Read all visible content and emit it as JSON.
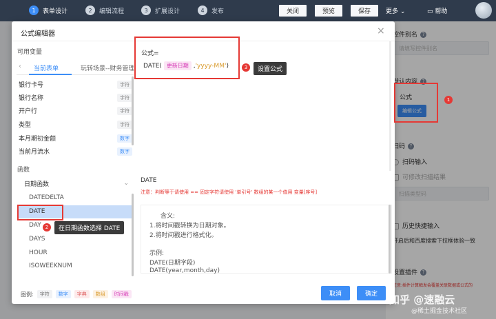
{
  "topbar": {
    "steps": [
      {
        "num": "1",
        "label": "表单设计"
      },
      {
        "num": "2",
        "label": "编辑流程"
      },
      {
        "num": "3",
        "label": "扩展设计"
      },
      {
        "num": "4",
        "label": "发布"
      }
    ],
    "buttons": {
      "close": "关闭",
      "preview": "预览",
      "save": "保存"
    },
    "more": "更多",
    "help": "帮助"
  },
  "right_panel": {
    "alias_label": "控件别名",
    "alias_placeholder": "请填写控件别名",
    "default_label": "默认内容",
    "default_value": "公式",
    "edit_formula": "编辑公式",
    "scan_label": "扫码",
    "scan_input": "扫码输入",
    "scan_modify": "可修改扫描结果",
    "scan_type": "扫描类型码",
    "history": "历史快捷输入",
    "baidu": "开启后和百度搜索下拉框体验一致",
    "plugin_label": "设置插件",
    "plugin_note": "注意:插件计算触发会覆盖关联数据或公式的"
  },
  "modal": {
    "title": "公式编辑器",
    "available_vars": "可用变量",
    "tabs": [
      "当前表单",
      "玩转场景--财务管理"
    ],
    "fields": [
      {
        "name": "银行卡号",
        "type": "字符"
      },
      {
        "name": "银行名称",
        "type": "字符"
      },
      {
        "name": "开户行",
        "type": "字符"
      },
      {
        "name": "类型",
        "type": "字符"
      },
      {
        "name": "本月期初金额",
        "type": "数字"
      },
      {
        "name": "当前月流水",
        "type": "数字"
      }
    ],
    "functions_label": "函数",
    "fn_group": "日期函数",
    "functions": [
      "DATEDELTA",
      "DATE",
      "DAY",
      "DAYS",
      "HOUR",
      "ISOWEEKNUM"
    ],
    "formula_label": "公式=",
    "formula": {
      "fn": "DATE(",
      "field": "更新日期",
      "comma": ",",
      "fmt": "'yyyy-MM'",
      "close": ")"
    },
    "fn_name": "DATE",
    "note": "注意：判断等于请使用 == 固定字符请使用 '单引号' 数组的某一个值用 变量[序号]",
    "desc": {
      "title": "含义:",
      "lines": [
        "1.将时间戳转换为日期对象。",
        "2.将时间戳进行格式化。"
      ],
      "example_title": "示例:",
      "examples": [
        "DATE(日期字段)",
        "DATE(year,month,day)"
      ]
    },
    "legend": {
      "label": "图例:",
      "items": [
        "字符",
        "数字",
        "字典",
        "数组",
        "时间戳"
      ]
    },
    "cancel": "取消",
    "confirm": "确定"
  },
  "annotations": {
    "m1": "1",
    "m2": "2",
    "m3": "3",
    "callout2": "在日期函数选择 DATE",
    "callout3": "设置公式"
  },
  "watermark": {
    "main": "知乎 @速融云",
    "sub": "@稀土掘金技术社区"
  }
}
